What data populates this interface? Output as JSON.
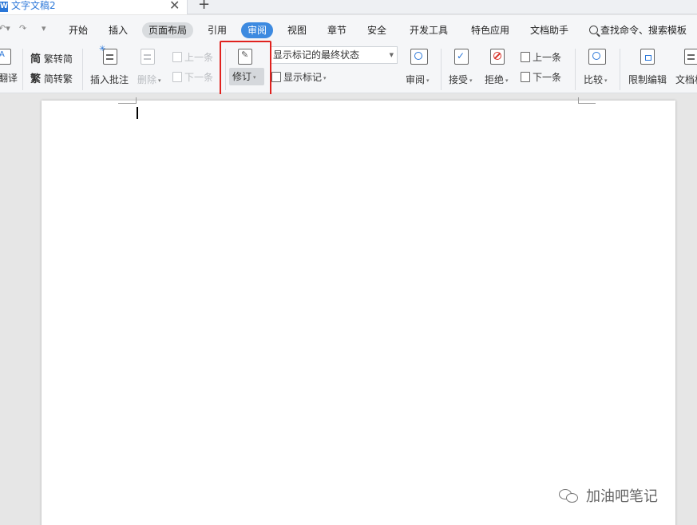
{
  "titlebar": {
    "doc_title": "文字文稿2",
    "close_symbol": "✕",
    "new_tab_symbol": "+"
  },
  "menu": {
    "tabs": [
      "开始",
      "插入",
      "页面布局",
      "引用",
      "审阅",
      "视图",
      "章节",
      "安全",
      "开发工具",
      "特色应用",
      "文档助手"
    ],
    "active_tab": "审阅",
    "hover_tab": "页面布局",
    "search_label": "查找命令、搜索模板"
  },
  "ribbon": {
    "translate_label": "翻译",
    "trad_convert_label": "繁转简",
    "simp_convert_label": "简转繁",
    "insert_comment_label": "插入批注",
    "delete_label": "删除",
    "prev_comment_label": "上一条",
    "next_comment_label": "下一条",
    "track_changes_label": "修订",
    "markup_dropdown_value": "显示标记的最终状态",
    "show_markup_label": "显示标记",
    "review_label": "审阅",
    "accept_label": "接受",
    "reject_label": "拒绝",
    "prev_change_label": "上一条",
    "next_change_label": "下一条",
    "compare_label": "比较",
    "restrict_edit_label": "限制编辑",
    "doc_permission_label": "文档权"
  },
  "watermark": {
    "text": "加油吧笔记"
  },
  "colors": {
    "accent": "#3d8ae0",
    "highlight_box": "#e0221e",
    "reject_icon": "#d9342b"
  }
}
